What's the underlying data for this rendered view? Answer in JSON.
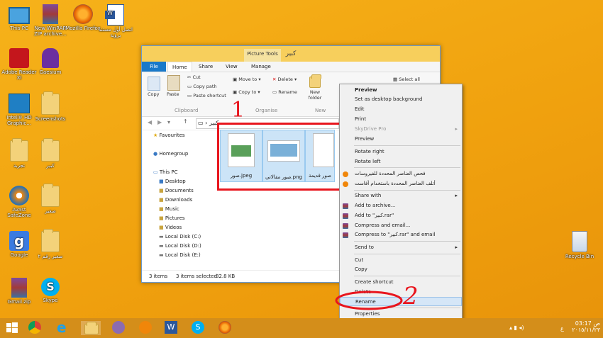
{
  "desktop": {
    "icons": [
      {
        "label": "This PC"
      },
      {
        "label": "New WinRAR ZIP archive..."
      },
      {
        "label": "Mozilla Firefox"
      },
      {
        "label": "اتصل أول مستند برؤية"
      },
      {
        "label": "Adobe Reader XI"
      },
      {
        "label": "Gaesium"
      },
      {
        "label": "Intel® HD Graphic..."
      },
      {
        "label": "Screenshots"
      },
      {
        "label": "تجربة"
      },
      {
        "label": "كبير"
      },
      {
        "label": "Avast SafeZone"
      },
      {
        "label": "صغير"
      },
      {
        "label": "Google"
      },
      {
        "label": "صغير رقم ٢"
      },
      {
        "label": "Gmail.zip"
      },
      {
        "label": "Skype"
      },
      {
        "label": "Recycle Bin"
      }
    ]
  },
  "window": {
    "title": "كبير",
    "picture_tools": "Picture Tools",
    "tabs": [
      "File",
      "Home",
      "Share",
      "View",
      "Manage"
    ],
    "ribbon": {
      "copy": "Copy",
      "paste": "Paste",
      "cut": "Cut",
      "copy_path": "Copy path",
      "paste_shortcut": "Paste shortcut",
      "clipboard": "Clipboard",
      "move_to": "Move to",
      "delete": "Delete",
      "copy_to": "Copy to",
      "rename": "Rename",
      "organise": "Organise",
      "new_folder": "New folder",
      "new": "New",
      "select_all": "Select all"
    },
    "address": "كبير",
    "nav": {
      "favourites": "Favourites",
      "homegroup": "Homegroup",
      "this_pc": "This PC",
      "desktop": "Desktop",
      "documents": "Documents",
      "downloads": "Downloads",
      "music": "Music",
      "pictures": "Pictures",
      "videos": "Videos",
      "disk_c": "Local Disk (C:)",
      "disk_d": "Local Disk (D:)",
      "disk_e": "Local Disk (E:)"
    },
    "files": [
      {
        "name": "صور.jpeg"
      },
      {
        "name": "صور مقالاتي.png"
      },
      {
        "name": "صور قديمة"
      }
    ],
    "status": {
      "items": "3 items",
      "selected": "3 items selected",
      "size": "82.8 KB"
    }
  },
  "context_menu": {
    "items": [
      {
        "label": "Preview"
      },
      {
        "label": "Set as desktop background"
      },
      {
        "label": "Edit"
      },
      {
        "label": "Print"
      },
      {
        "label": "SkyDrive Pro"
      },
      {
        "label": "Preview"
      },
      {
        "label": "Rotate right"
      },
      {
        "label": "Rotate left"
      },
      {
        "label": "فحص العناصر المحددة للفيروسات"
      },
      {
        "label": "أتلف العناصر المحددة باستخدام أفاست"
      },
      {
        "label": "Share with"
      },
      {
        "label": "Add to archive..."
      },
      {
        "label": "Add to \"كبير.rar\""
      },
      {
        "label": "Compress and email..."
      },
      {
        "label": "Compress to \"كبير.rar\" and email"
      },
      {
        "label": "Send to"
      },
      {
        "label": "Cut"
      },
      {
        "label": "Copy"
      },
      {
        "label": "Create shortcut"
      },
      {
        "label": "Delete"
      },
      {
        "label": "Rename"
      },
      {
        "label": "Properties"
      }
    ]
  },
  "annotations": {
    "one": "1",
    "two": "2"
  },
  "taskbar": {
    "time": "03:17",
    "period": "ص",
    "date": "٢٠١٥/١١/٢٣",
    "lang": "ع"
  },
  "colors": {
    "accent": "#1979ca",
    "highlight": "#d5e6f7",
    "annotation": "#e8161e"
  }
}
